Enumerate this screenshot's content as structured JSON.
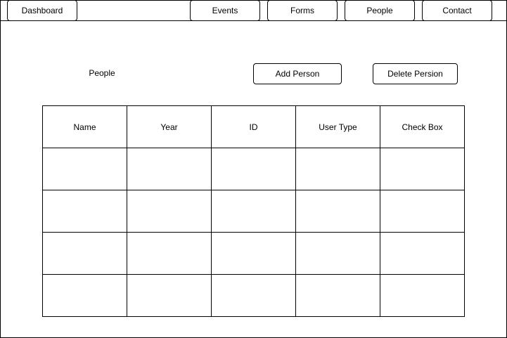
{
  "nav": {
    "dashboard": "Dashboard",
    "events": "Events",
    "forms": "Forms",
    "people": "People",
    "contact": "Contact"
  },
  "main": {
    "title": "People",
    "add_button": "Add Person",
    "delete_button": "Delete Persion"
  },
  "table": {
    "headers": [
      "Name",
      "Year",
      "ID",
      "User Type",
      "Check Box"
    ],
    "rows": [
      [
        "",
        "",
        "",
        "",
        ""
      ],
      [
        "",
        "",
        "",
        "",
        ""
      ],
      [
        "",
        "",
        "",
        "",
        ""
      ],
      [
        "",
        "",
        "",
        "",
        ""
      ]
    ]
  },
  "colors": {
    "border": "#000000",
    "background": "#ffffff"
  }
}
